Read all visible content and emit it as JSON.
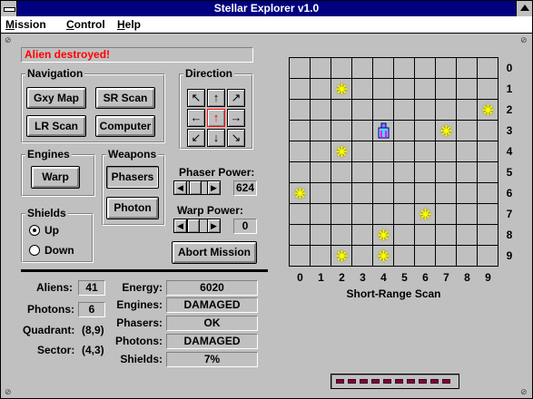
{
  "window": {
    "title": "Stellar Explorer v1.0"
  },
  "menu": {
    "items": [
      "Mission",
      "Control",
      "Help"
    ]
  },
  "status_message": "Alien destroyed!",
  "navigation": {
    "legend": "Navigation",
    "buttons": [
      "Gxy Map",
      "SR Scan",
      "LR Scan",
      "Computer"
    ]
  },
  "direction": {
    "legend": "Direction",
    "arrows": [
      "↖",
      "↑",
      "↗",
      "←",
      "↑",
      "→",
      "↙",
      "↓",
      "↘"
    ],
    "active_index": 4
  },
  "engines": {
    "legend": "Engines",
    "button": "Warp"
  },
  "weapons": {
    "legend": "Weapons",
    "buttons": [
      "Phasers",
      "Photon"
    ]
  },
  "shields_group": {
    "legend": "Shields",
    "options": [
      "Up",
      "Down"
    ],
    "selected": "Up"
  },
  "phaser_power": {
    "label": "Phaser Power:",
    "value": "624",
    "level": 0.3
  },
  "warp_power": {
    "label": "Warp Power:",
    "value": "0",
    "level": 0
  },
  "abort_button": "Abort Mission",
  "stats_left": [
    {
      "label": "Aliens:",
      "value": "41"
    },
    {
      "label": "Photons:",
      "value": "6"
    },
    {
      "label": "Quadrant:",
      "value": "(8,9)"
    },
    {
      "label": "Sector:",
      "value": "(4,3)"
    }
  ],
  "stats_right": [
    {
      "label": "Energy:",
      "value": "6020"
    },
    {
      "label": "Engines:",
      "value": "DAMAGED"
    },
    {
      "label": "Phasers:",
      "value": "OK"
    },
    {
      "label": "Photons:",
      "value": "DAMAGED"
    },
    {
      "label": "Shields:",
      "value": "7%"
    }
  ],
  "scan": {
    "caption": "Short-Range Scan",
    "row_labels": [
      "0",
      "1",
      "2",
      "3",
      "4",
      "5",
      "6",
      "7",
      "8",
      "9"
    ],
    "col_labels": [
      "0",
      "1",
      "2",
      "3",
      "4",
      "5",
      "6",
      "7",
      "8",
      "9"
    ],
    "stars": [
      [
        2,
        1
      ],
      [
        9,
        2
      ],
      [
        7,
        3
      ],
      [
        2,
        4
      ],
      [
        0,
        6
      ],
      [
        6,
        7
      ],
      [
        4,
        8
      ],
      [
        2,
        9
      ],
      [
        4,
        9
      ]
    ],
    "ship": [
      4,
      3
    ]
  },
  "colors": {
    "title_bar": "#000080",
    "status_text": "#ff0000",
    "star": "#ffff00",
    "indicator_led": "#800040"
  },
  "icons": {
    "star": "star-icon",
    "ship": "starship-icon"
  },
  "indicator": {
    "leds": 10
  }
}
